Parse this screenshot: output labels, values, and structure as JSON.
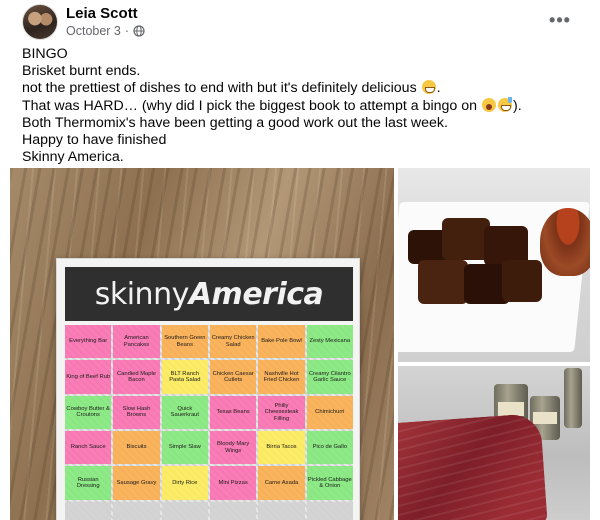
{
  "post": {
    "author": "Leia Scott",
    "date": "October 3",
    "separator": "·",
    "more_label": "•••",
    "lines": [
      "BINGO",
      "Brisket burnt ends.",
      "not the prettiest of dishes to end with but it's definitely delicious",
      ".",
      "That was HARD… (why did I pick the biggest book to attempt a bingo on",
      ").",
      "Both Thermomix's have been getting a good work out the last week.",
      "Happy to have finished",
      "Skinny America."
    ]
  },
  "bingo_card": {
    "title_part1": "skinny",
    "title_part2": "America",
    "cells": [
      {
        "label": "Everything Bar",
        "color": "pink"
      },
      {
        "label": "American Pancakes",
        "color": "pink"
      },
      {
        "label": "Southern Green Beans",
        "color": "orange"
      },
      {
        "label": "Creamy Chicken Salad",
        "color": "orange"
      },
      {
        "label": "Bake Pole Bowl",
        "color": "orange"
      },
      {
        "label": "Zesty Mexicana",
        "color": "green"
      },
      {
        "label": "King of Beef Rub",
        "color": "pink"
      },
      {
        "label": "Candied Maple Bacon",
        "color": "pink"
      },
      {
        "label": "BLT Ranch Pasta Salad",
        "color": "yellow"
      },
      {
        "label": "Chicken Caesar Cutlets",
        "color": "orange"
      },
      {
        "label": "Nashville Hot Fried Chicken",
        "color": "orange"
      },
      {
        "label": "Creamy Cilantro Garlic Sauce",
        "color": "green"
      },
      {
        "label": "Cowboy Butter & Croutons",
        "color": "green"
      },
      {
        "label": "Slow Hash Browns",
        "color": "pink"
      },
      {
        "label": "Quick Sauerkraut",
        "color": "green"
      },
      {
        "label": "Texas Beans",
        "color": "pink"
      },
      {
        "label": "Philly Cheesesteak Filling",
        "color": "pink"
      },
      {
        "label": "Chimichurri",
        "color": "orange"
      },
      {
        "label": "Ranch Sauce",
        "color": "pink"
      },
      {
        "label": "Biscuits",
        "color": "orange"
      },
      {
        "label": "Simple Slaw",
        "color": "green"
      },
      {
        "label": "Bloody Mary Wings",
        "color": "pink"
      },
      {
        "label": "Birria Tacos",
        "color": "yellow"
      },
      {
        "label": "Pico de Gallo",
        "color": "green"
      },
      {
        "label": "Russian Dressing",
        "color": "green"
      },
      {
        "label": "Sausage Gravy",
        "color": "orange"
      },
      {
        "label": "Dirty Rice",
        "color": "yellow"
      },
      {
        "label": "Mini Pizzas",
        "color": "pink"
      },
      {
        "label": "Carne Asada",
        "color": "orange"
      },
      {
        "label": "Pickled Cabbage & Onion",
        "color": "green"
      },
      {
        "label": "",
        "color": "gray"
      },
      {
        "label": "",
        "color": "gray"
      },
      {
        "label": "",
        "color": "gray"
      },
      {
        "label": "",
        "color": "gray"
      },
      {
        "label": "",
        "color": "gray"
      },
      {
        "label": "",
        "color": "gray"
      }
    ]
  },
  "colors": {
    "author": "#050505",
    "meta": "#65676b",
    "pink": "#ff5faa",
    "orange": "#ffa840",
    "green": "#78eb6e",
    "yellow": "#ffec50"
  },
  "icons": {
    "audience": "globe-icon",
    "more": "more-horizontal-icon"
  }
}
